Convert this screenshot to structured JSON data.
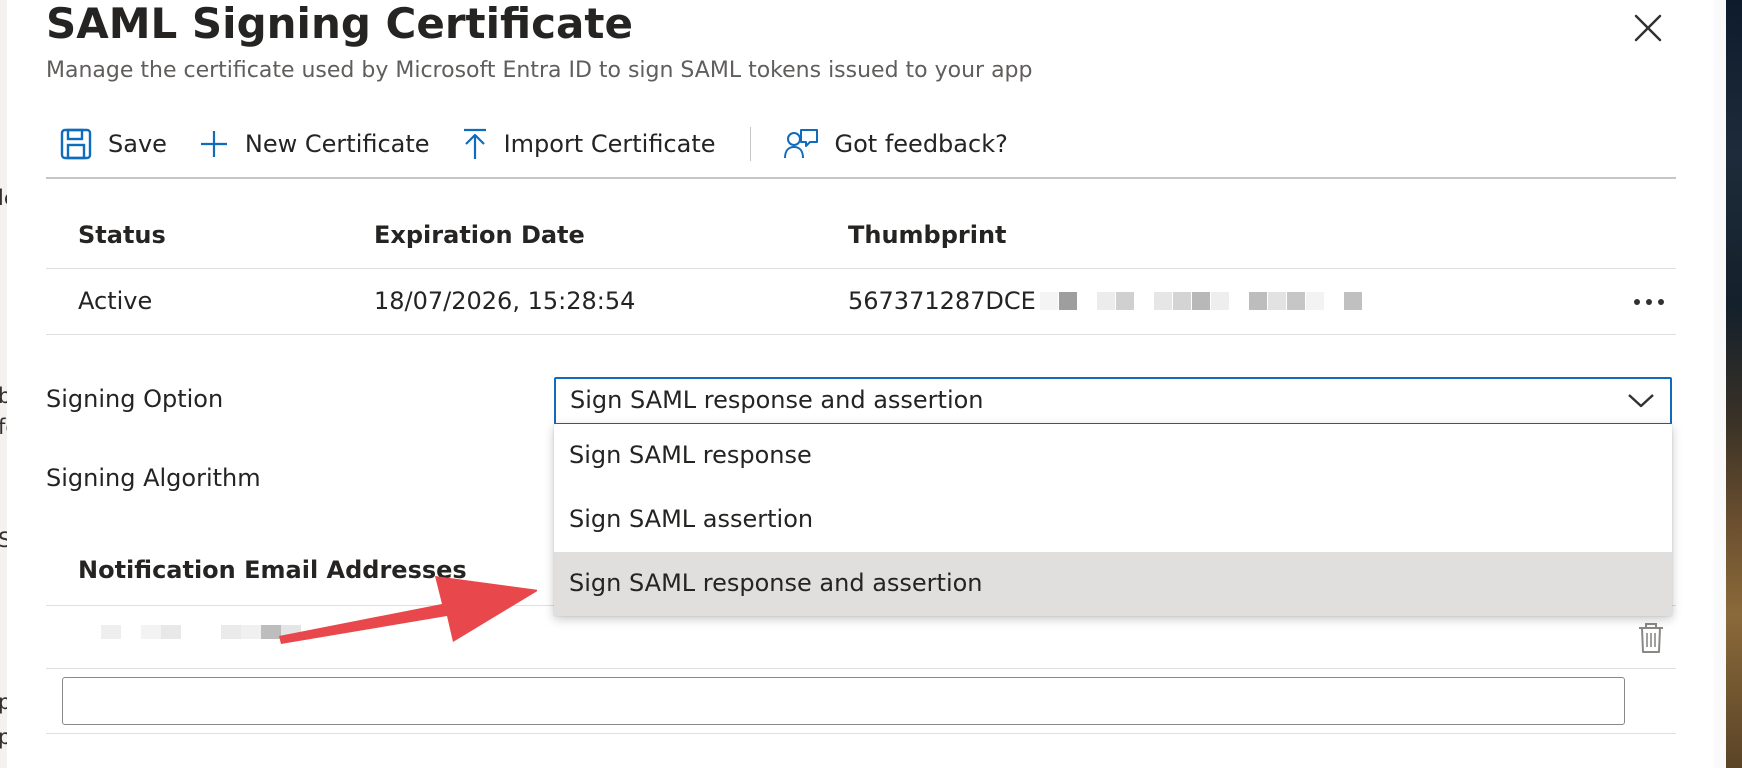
{
  "background": {
    "left_fragments": [
      "le",
      "b",
      "fo",
      "S",
      "p",
      "p"
    ]
  },
  "panel": {
    "title": "SAML Signing Certificate",
    "subtitle": "Manage the certificate used by Microsoft Entra ID to sign SAML tokens issued to your app"
  },
  "toolbar": {
    "save_label": "Save",
    "new_certificate_label": "New Certificate",
    "import_certificate_label": "Import Certificate",
    "feedback_label": "Got feedback?"
  },
  "certificates": {
    "columns": [
      "Status",
      "Expiration Date",
      "Thumbprint"
    ],
    "rows": [
      {
        "status": "Active",
        "expiration": "18/07/2026, 15:28:54",
        "thumbprint": "567371287DCE"
      }
    ]
  },
  "signing_option": {
    "label": "Signing Option",
    "selected": "Sign SAML response and assertion",
    "options": [
      "Sign SAML response",
      "Sign SAML assertion",
      "Sign SAML response and assertion"
    ],
    "highlighted_index": 2
  },
  "signing_algorithm": {
    "label": "Signing Algorithm"
  },
  "notifications": {
    "header": "Notification Email Addresses",
    "new_email_value": ""
  },
  "colors": {
    "accent": "#0f6cbd",
    "annotation_arrow": "#e8484b",
    "highlight": "#e1dfdd"
  },
  "icons": {
    "close": "close-icon",
    "save": "save-icon",
    "new": "plus-icon",
    "import": "import-icon",
    "feedback": "feedback-icon",
    "more": "more-icon",
    "chevron": "chevron-down-icon",
    "delete": "trash-icon"
  }
}
